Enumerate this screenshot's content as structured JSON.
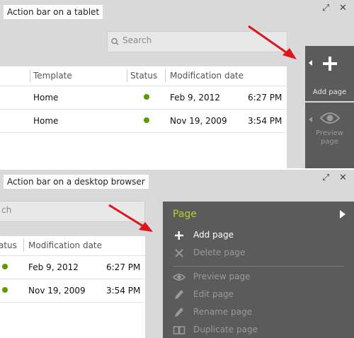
{
  "tablet": {
    "caption": "Action bar on a tablet",
    "controls": {
      "expand": "⤢",
      "close": "✕"
    },
    "search": {
      "placeholder": "Search"
    },
    "columns": {
      "template": "Template",
      "status": "Status",
      "modified": "Modification date"
    },
    "rows": [
      {
        "template": "Home",
        "status": "published",
        "date": "Feb 9, 2012",
        "time": "6:27 PM"
      },
      {
        "template": "Home",
        "status": "published",
        "date": "Nov 19, 2009",
        "time": "3:54 PM"
      }
    ],
    "action_bar": {
      "add_page": {
        "label": "Add page",
        "icon": "plus-icon",
        "enabled": true
      },
      "preview_page": {
        "label_line1": "Preview",
        "label_line2": "page",
        "icon": "eye-icon",
        "enabled": false
      }
    }
  },
  "desktop": {
    "caption": "Action bar on a desktop browser",
    "controls": {
      "expand": "⤢",
      "close": "✕"
    },
    "search": {
      "visible_text": "ch"
    },
    "columns": {
      "status": "atus",
      "modified": "Modification date"
    },
    "rows": [
      {
        "status": "published",
        "date": "Feb 9, 2012",
        "time": "6:27 PM"
      },
      {
        "status": "published",
        "date": "Nov 19, 2009",
        "time": "3:54 PM"
      }
    ],
    "menu": {
      "title": "Page",
      "items": [
        {
          "label": "Add page",
          "icon": "plus-icon",
          "enabled": true
        },
        {
          "label": "Delete page",
          "icon": "x-icon",
          "enabled": false
        },
        {
          "label": "Preview page",
          "icon": "eye-icon",
          "enabled": false
        },
        {
          "label": "Edit page",
          "icon": "pencil-icon",
          "enabled": false
        },
        {
          "label": "Rename page",
          "icon": "pencil-icon",
          "enabled": false
        },
        {
          "label": "Duplicate page",
          "icon": "duplicate-icon",
          "enabled": false
        }
      ]
    }
  },
  "colors": {
    "action_bar_bg": "#5b5b5b",
    "menu_title": "#b5cf2c",
    "status_dot": "#5e9a07",
    "annotation_arrow": "#e0141b",
    "panel_bg": "#d9d9d9"
  }
}
